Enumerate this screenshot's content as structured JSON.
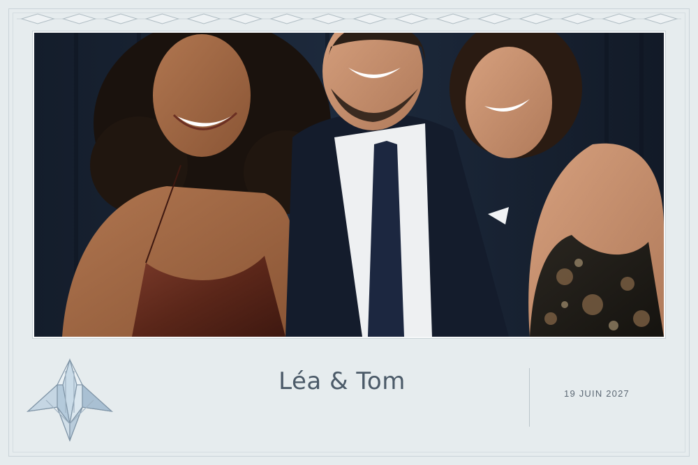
{
  "card": {
    "names": "Léa & Tom",
    "date": "19 JUIN 2027"
  },
  "photo": {
    "icon": "group-photo",
    "background_color": "#1a2536"
  },
  "decor": {
    "emblem_icon": "art-deco-crystal-icon",
    "border_pattern": "diamond-band",
    "accent_color": "#4b5a68"
  }
}
